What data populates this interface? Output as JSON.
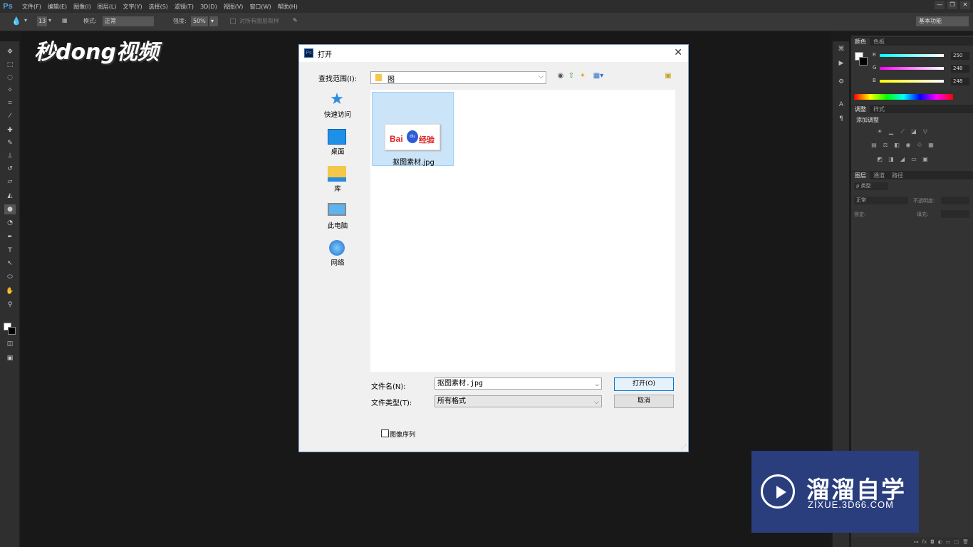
{
  "app": {
    "logo": "Ps",
    "menu": [
      "文件(F)",
      "编辑(E)",
      "图像(I)",
      "图层(L)",
      "文字(Y)",
      "选择(S)",
      "滤镜(T)",
      "3D(D)",
      "视图(V)",
      "窗口(W)",
      "帮助(H)"
    ],
    "window_controls": [
      "—",
      "❐",
      "✕"
    ]
  },
  "options_bar": {
    "brush_size": "13",
    "mode_label": "模式:",
    "mode_value": "正常",
    "strength_label": "强度:",
    "strength_value": "50%",
    "sample_all_label": "对所有图层取样",
    "workspace": "基本功能"
  },
  "canvas": {
    "overlay_logo": "秒dong视频"
  },
  "panels": {
    "color_tabs": [
      "颜色",
      "色板"
    ],
    "rgb": [
      {
        "label": "R",
        "value": "250",
        "color": "#ff7070"
      },
      {
        "label": "G",
        "value": "248",
        "color": "#ff70ff"
      },
      {
        "label": "B",
        "value": "248",
        "color": "#f0e040"
      }
    ],
    "adjust_tabs": [
      "调整",
      "样式"
    ],
    "adjust_title": "添加调整",
    "layers_tabs": [
      "图层",
      "通道",
      "路径"
    ],
    "layers_filter": "ρ 类型",
    "blend_mode": "正常",
    "opacity_label": "不透明度:",
    "lock_label": "锁定:",
    "fill_label": "填充:"
  },
  "dialog": {
    "title": "打开",
    "look_in_label": "查找范围(I):",
    "look_in_value": "图",
    "places": [
      {
        "label": "快速访问",
        "icon": "star-icon"
      },
      {
        "label": "桌面",
        "icon": "desktop-icon"
      },
      {
        "label": "库",
        "icon": "library-icon"
      },
      {
        "label": "此电脑",
        "icon": "computer-icon"
      },
      {
        "label": "网络",
        "icon": "network-icon"
      }
    ],
    "file": {
      "name": "抠图素材.jpg",
      "thumb_bai": "Bai",
      "thumb_du": "du",
      "thumb_jy": "经验"
    },
    "filename_label": "文件名(N):",
    "filename_value": "抠图素材.jpg",
    "filetype_label": "文件类型(T):",
    "filetype_value": "所有格式",
    "open_button": "打开(O)",
    "cancel_button": "取消",
    "image_sequence_label": "图像序列"
  },
  "watermark": {
    "title": "溜溜自学",
    "url": "ZIXUE.3D66.COM"
  }
}
